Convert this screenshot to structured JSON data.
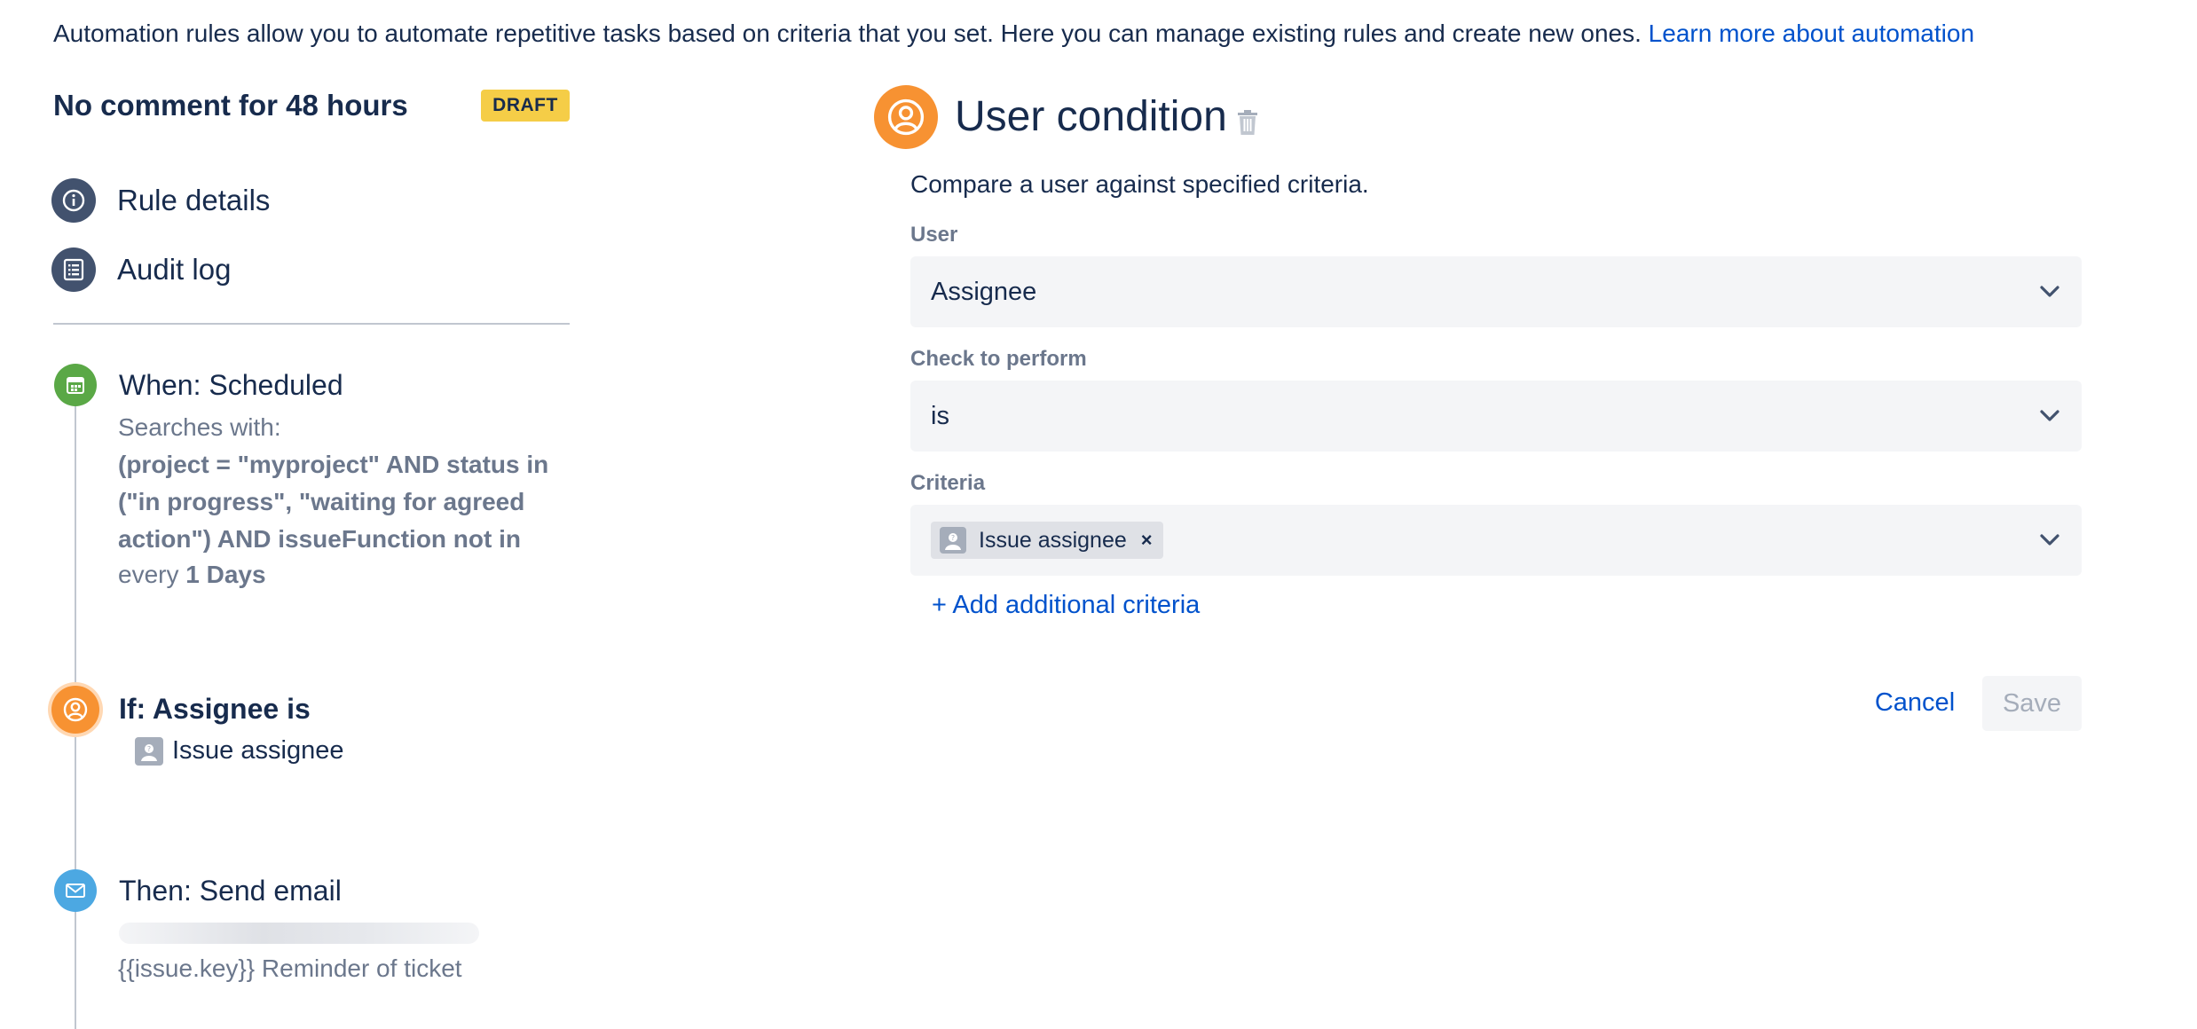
{
  "intro": {
    "text": "Automation rules allow you to automate repetitive tasks based on criteria that you set. Here you can manage existing rules and create new ones. ",
    "link_label": "Learn more about automation"
  },
  "rule": {
    "title": "No comment for 48 hours",
    "status_badge": "DRAFT"
  },
  "nav": {
    "items": [
      {
        "label": "Rule details",
        "icon": "info-icon"
      },
      {
        "label": "Audit log",
        "icon": "list-icon"
      }
    ]
  },
  "steps": {
    "trigger": {
      "title": "When: Scheduled",
      "searches_label": "Searches with:",
      "jql": "(project = \"myproject\" AND status in (\"in progress\", \"waiting for agreed action\") AND issueFunction not in",
      "every_prefix": "every ",
      "every_value": "1 Days",
      "icon": "calendar-icon",
      "color": "#5aa846"
    },
    "condition": {
      "title": "If: Assignee is",
      "detail": "Issue assignee",
      "icon": "user-icon",
      "color": "#f79232"
    },
    "action": {
      "title": "Then: Send email",
      "subject": "{{issue.key}} Reminder of ticket",
      "icon": "mail-icon",
      "color": "#4ca8e2"
    }
  },
  "editor": {
    "title": "User condition",
    "description": "Compare a user against specified criteria.",
    "user": {
      "label": "User",
      "value": "Assignee"
    },
    "check": {
      "label": "Check to perform",
      "value": "is"
    },
    "criteria": {
      "label": "Criteria",
      "tags": [
        "Issue assignee"
      ],
      "add_label": "+ Add additional criteria"
    },
    "cancel_label": "Cancel",
    "save_label": "Save"
  },
  "colors": {
    "link": "#0052cc",
    "badge": "#f5cd47",
    "nav_icon": "#42526e",
    "field_bg": "#f4f5f7"
  }
}
